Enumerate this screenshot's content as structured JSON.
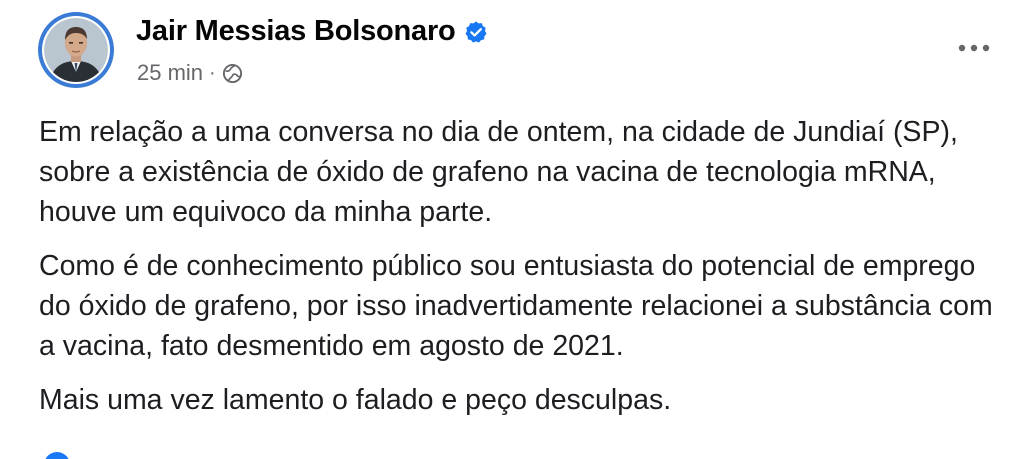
{
  "author": {
    "name": "Jair Messias Bolsonaro",
    "verified_icon": "verified-badge-icon",
    "avatar_icon": "profile-photo"
  },
  "meta": {
    "timestamp": "25 min",
    "separator": "·",
    "audience_icon": "globe-icon"
  },
  "menu": {
    "icon": "more-options-icon"
  },
  "body": {
    "paragraphs": [
      "Em relação a uma conversa no dia de ontem, na cidade de Jundiaí (SP), sobre a existência de óxido de grafeno na vacina de tecnologia mRNA, houve um equivoco da minha parte.",
      "Como é de conhecimento público sou entusiasta do potencial de emprego do óxido de grafeno, por isso inadvertidamente relacionei a substância com a vacina, fato desmentido em agosto de 2021.",
      "Mais uma vez lamento o falado e peço desculpas."
    ]
  },
  "colors": {
    "accent": "#1877f2",
    "avatar_ring": "#3a7bd5",
    "secondary_text": "#65676b"
  }
}
